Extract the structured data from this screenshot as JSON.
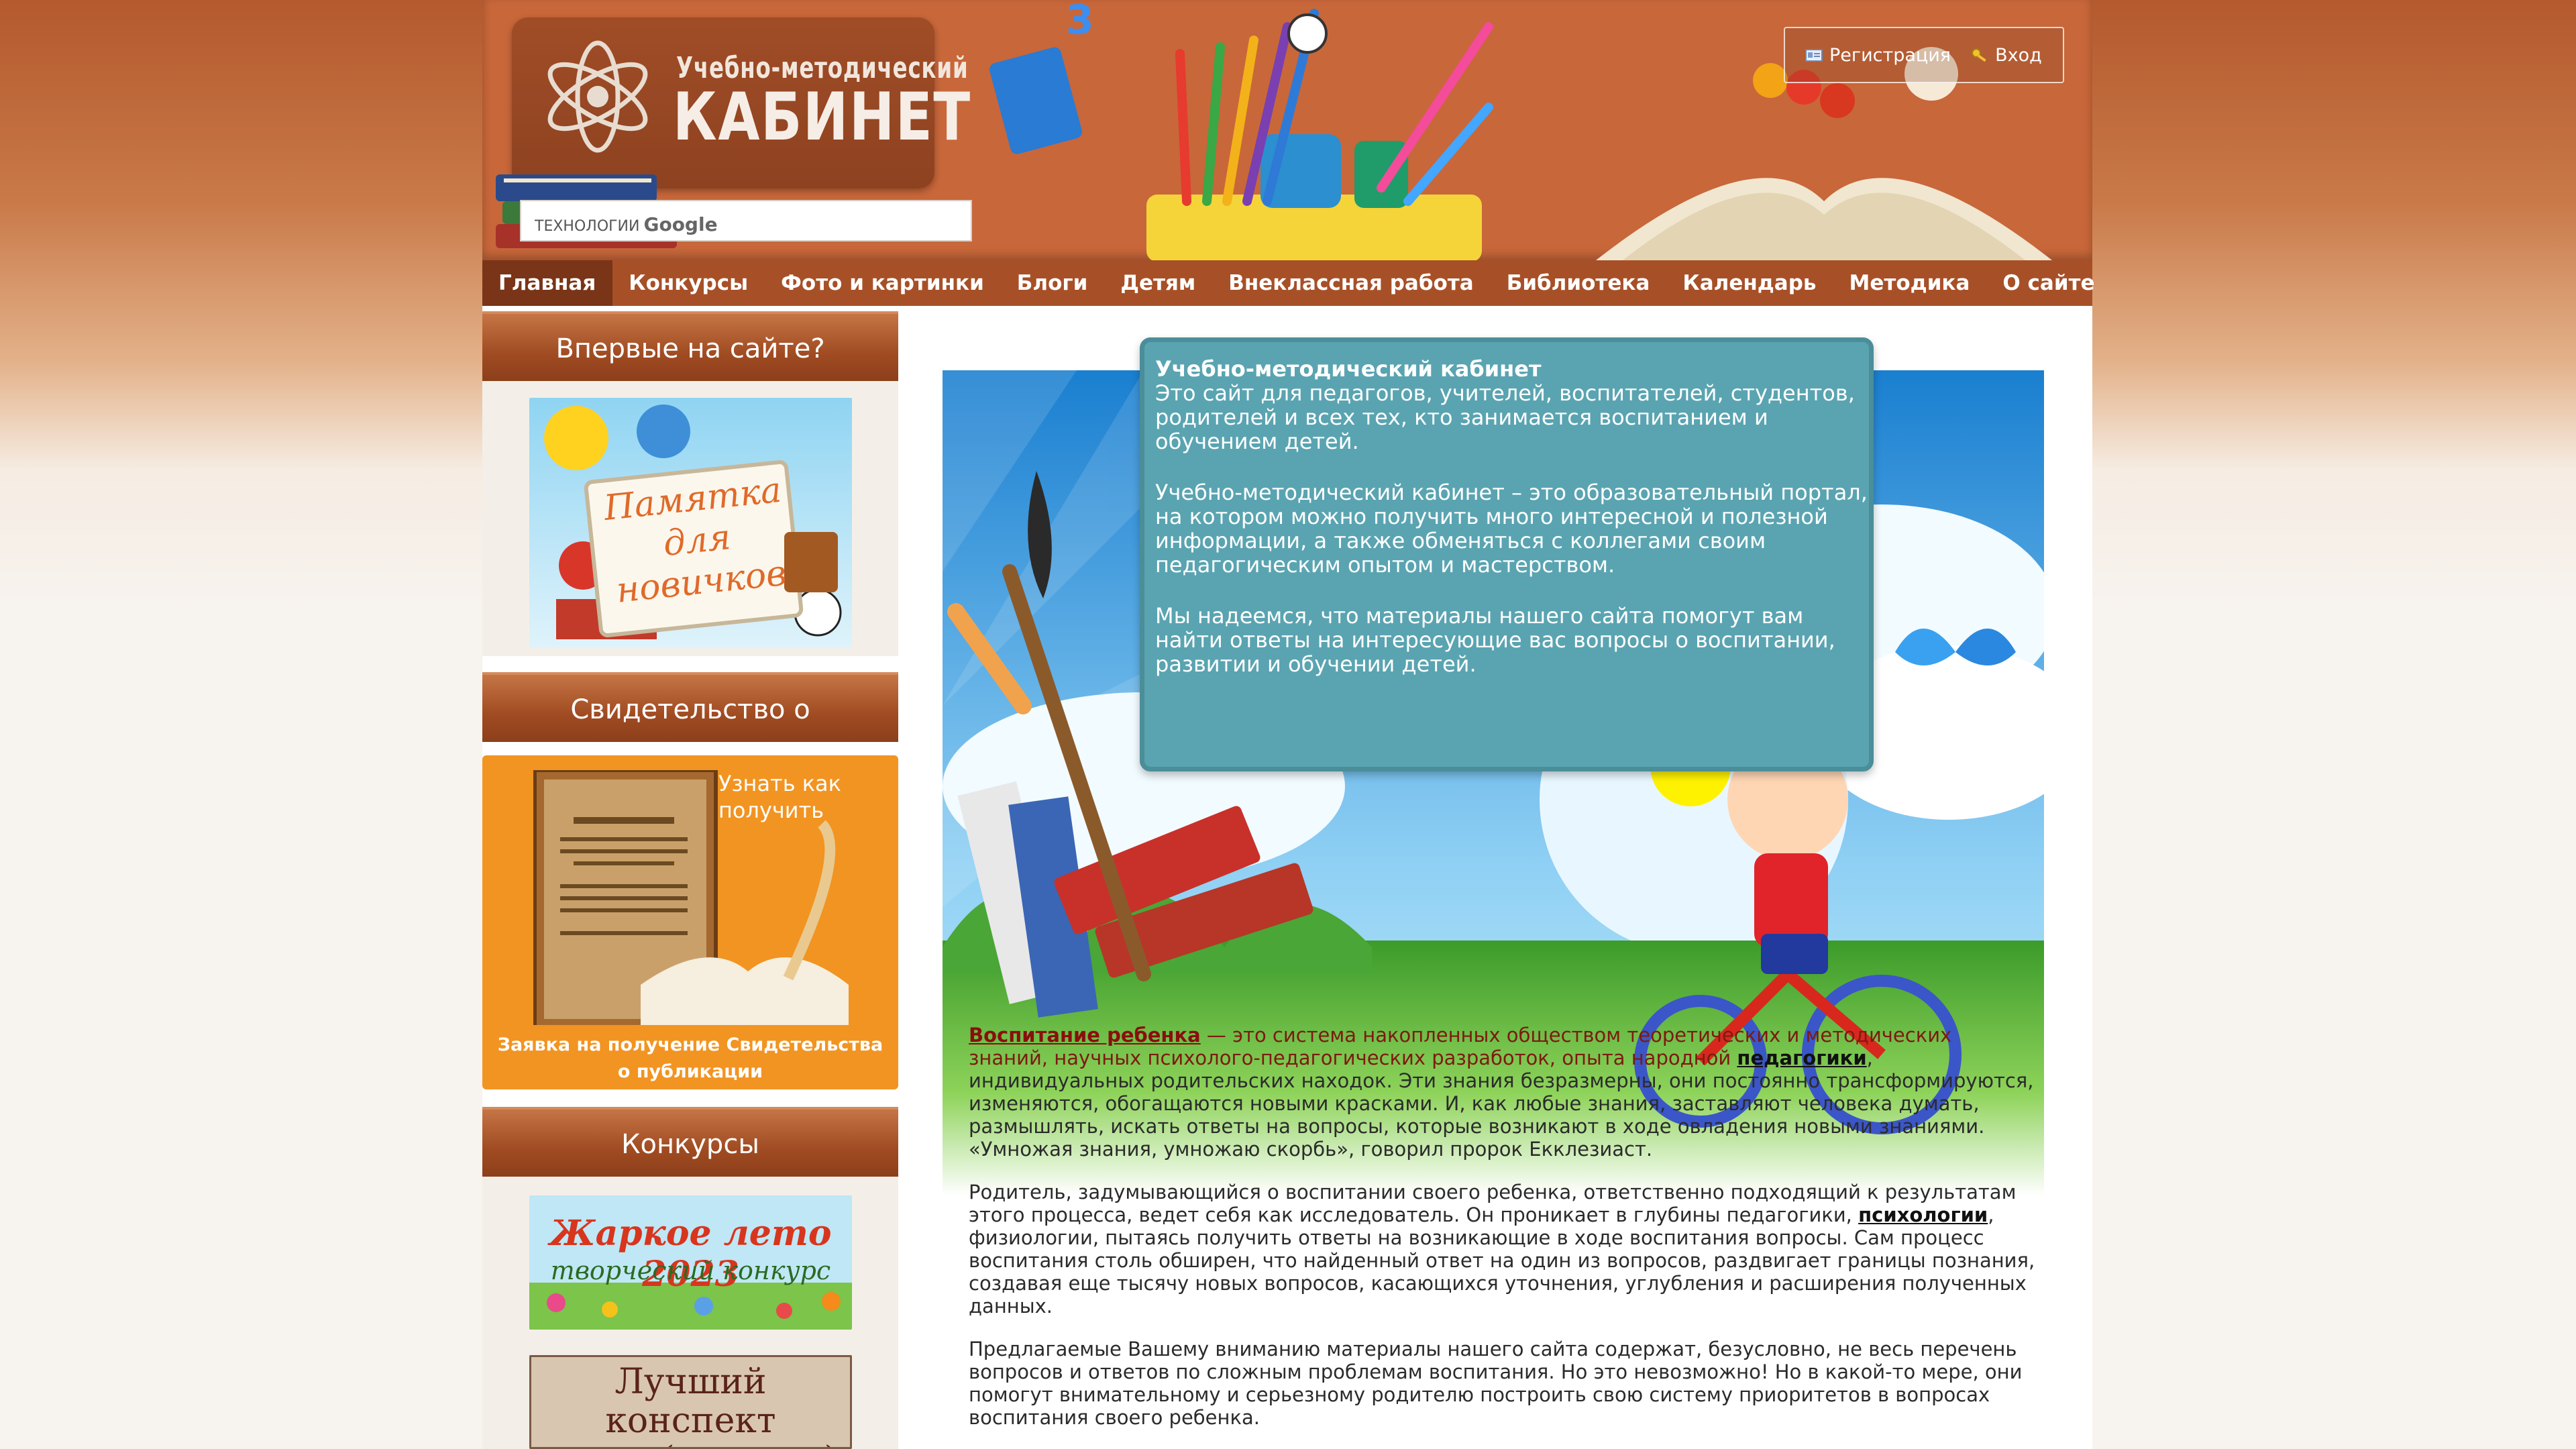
{
  "header": {
    "logo_line1": "Учебно-методический",
    "logo_line2": "КАБИНЕТ",
    "search_placeholder_prefix": "ТЕХНОЛОГИИ",
    "search_placeholder_brand": "Google",
    "register_label": "Регистрация",
    "login_label": "Вход"
  },
  "nav": {
    "items": [
      "Главная",
      "Конкурсы",
      "Фото и картинки",
      "Блоги",
      "Детям",
      "Внеклассная работа",
      "Библиотека",
      "Календарь",
      "Методика",
      "О сайте"
    ]
  },
  "sidebar": {
    "newcomer_title": "Впервые на сайте?",
    "newcomer_banner_text": [
      "Памятка",
      "для",
      "новичков"
    ],
    "certificate_title": "Свидетельство о",
    "certificate_banner_text": "Узнать как получить",
    "certificate_caption": "Заявка на получение Свидетельства о публикации",
    "contests_title": "Конкурсы",
    "contest1_line1": "Жаркое лето 2023",
    "contest1_line2": "творческий конкурс",
    "contest2_line1": "Лучший конспект",
    "contest2_line2": "урока (занятия)"
  },
  "welcome": {
    "title": "Учебно-методический кабинет",
    "p1": "Это сайт для педагогов, учителей, воспитателей, студентов, родителей и всех тех, кто занимается воспитанием и обучением детей.",
    "p2": "Учебно-методический кабинет – это образовательный портал, на котором можно получить много интересной и полезной информации, а также обменяться с коллегами своим педагогическим опытом и мастерством.",
    "p3": "Мы надеемся, что материалы нашего сайта помогут вам найти ответы на интересующие вас вопросы о воспитании, развитии и обучении детей."
  },
  "article": {
    "p1_link": "Воспитание ребенка",
    "p1_lead": " — это система накопленных обществом теоретических и методических знаний, научных психолого-педагогических разработок, опыта народной ",
    "p1_link2": "педагогики",
    "p1_rest": ", индивидуальных родительских находок. Эти знания безразмерны, они постоянно трансформируются, изменяются, обогащаются новыми красками. И, как любые знания, заставляют человека думать, размышлять, искать ответы на вопросы, которые возникают в ходе овладения новыми знаниями. «Умножая знания, умножаю скорбь», говорил пророк Екклезиаст.",
    "p2_a": "Родитель, задумывающийся о воспитании своего ребенка, ответственно подходящий к результатам этого процесса, ведет себя как исследователь. Он проникает в глубины педагогики, ",
    "p2_link": "психологии",
    "p2_b": ", физиологии, пытаясь получить ответы на возникающие в ходе воспитания вопросы. Сам процесс воспитания столь обширен, что найденный ответ на один из вопросов, раздвигает границы познания, создавая еще тысячу новых вопросов, касающихся уточнения, углубления и расширения полученных данных.",
    "p3": "Предлагаемые Вашему вниманию материалы нашего сайта содержат, безусловно, не весь перечень вопросов и ответов по сложным проблемам воспитания. Но это невозможно! Но в какой-то мере, они помогут внимательному и серьезному родителю построить свою систему приоритетов в вопросах воспитания своего ребенка."
  },
  "colors": {
    "header": "#c8673a",
    "nav": "#a75027",
    "nav_active": "#7a3417",
    "welcome_box": "#5aa4b1",
    "certificate_panel": "#f29421"
  }
}
